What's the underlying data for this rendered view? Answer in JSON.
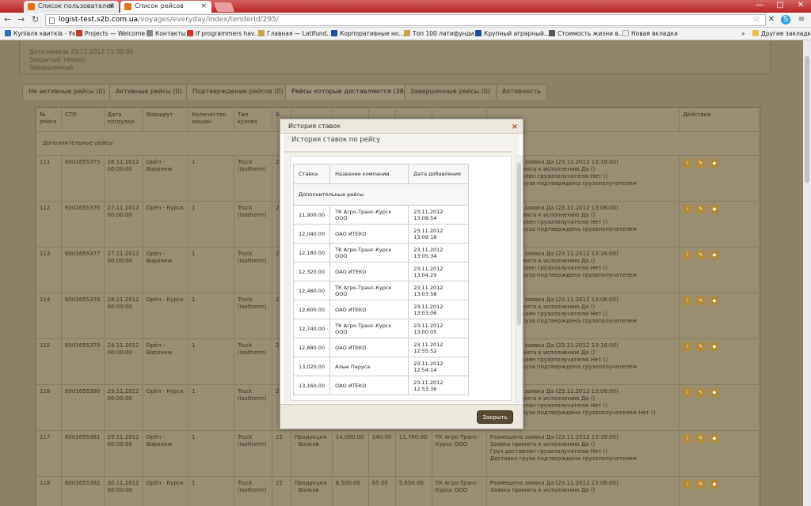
{
  "browser": {
    "tabs": [
      {
        "label": "Список пользователей",
        "close": "×"
      },
      {
        "label": "Список рейсов",
        "close": "×"
      }
    ],
    "window_buttons": {
      "minimize": "—",
      "maximize": "□",
      "close": "✕"
    },
    "nav": {
      "back": "←",
      "forward": "→",
      "reload": "↻"
    },
    "url_host": "logist-test.s2b.com.ua",
    "url_path": "/voyages/everyday/index/tenderId/295/",
    "star": "☆",
    "menu": "≡",
    "bookmarks": [
      {
        "label": "Купівля квитків - Ук...",
        "color": "#2b6fbf"
      },
      {
        "label": "Projects — Welcome",
        "color": "#c0392b"
      },
      {
        "label": "Контакты",
        "color": "#888"
      },
      {
        "label": "If programmers hav...",
        "color": "#d9342b"
      },
      {
        "label": "Главная — Latifund...",
        "color": "#c8a44a"
      },
      {
        "label": "Корпоративные но...",
        "color": "#1f4f9a"
      },
      {
        "label": "Топ 100 латифунди...",
        "color": "#c8a44a"
      },
      {
        "label": "Крупный аграрный...",
        "color": "#1f4f9a"
      },
      {
        "label": "Стоимость жизни в...",
        "color": "#555"
      },
      {
        "label": "Новая вкладка",
        "color": "#ddd"
      }
    ],
    "bookmarks_more": "»",
    "other_bookmarks": "Другие закладки"
  },
  "info": {
    "start": "Дата начала 23.11.2012 11:30:00",
    "type": "Закрытый тендер",
    "status": "Завершенный"
  },
  "page_tabs": [
    "Не активные рейсы (0)",
    "Активные рейсы (0)",
    "Подтверждение рейсов (0)",
    "Рейсы которые доставляются (38)",
    "Завершенные рейсы (0)",
    "Активность"
  ],
  "trips": {
    "caption": "Дополнительные рейсы",
    "headers": [
      "№ рейса",
      "СТО",
      "Дата погрузки",
      "Маршрут",
      "Количество машин",
      "Тип кузова",
      "В",
      "",
      "",
      "",
      "",
      "",
      "",
      "Действия"
    ],
    "rows": [
      {
        "num": "111",
        "sto": "6001655375",
        "date": "26.11.2012 00:00:00",
        "route": "Орёл - Воронеж",
        "qty": "1",
        "body": "Truck (Isotherm)",
        "w": "22",
        "cargo": "",
        "s1": "",
        "s2": "",
        "s3": "",
        "carrier": "",
        "status": [
          "Размещена заявка Да (23.11.2012 13:16:00)",
          "Заявка принята к исполнению Да ()",
          "Груз доставлен грузополучателю Нет ()",
          "Доставка груза подтверждена грузополучателем"
        ]
      },
      {
        "num": "112",
        "sto": "6001655376",
        "date": "27.11.2012 00:00:00",
        "route": "Орёл - Курск",
        "qty": "1",
        "body": "Truck (Isotherm)",
        "w": "22",
        "cargo": "",
        "s1": "",
        "s2": "",
        "s3": "",
        "carrier": "",
        "status": [
          "Размещена заявка Да (23.11.2012 13:06:00)",
          "Заявка принята к исполнению Да ()",
          "Груз доставлен грузополучателю Нет ()",
          "Доставка груза подтверждена грузополучателем"
        ]
      },
      {
        "num": "113",
        "sto": "6001655377",
        "date": "27.11.2012 00:00:00",
        "route": "Орёл - Воронеж",
        "qty": "1",
        "body": "Truck (Isotherm)",
        "w": "22",
        "cargo": "",
        "s1": "",
        "s2": "",
        "s3": "",
        "carrier": "",
        "status": [
          "Размещена заявка Да (23.11.2012 13:16:00)",
          "Заявка принята к исполнению Да ()",
          "Груз доставлен грузополучателю Нет ()",
          "Доставка груза подтверждена грузополучателем"
        ]
      },
      {
        "num": "114",
        "sto": "6001655378",
        "date": "28.11.2012 00:00:00",
        "route": "Орёл - Курск",
        "qty": "1",
        "body": "Truck (Isotherm)",
        "w": "22",
        "cargo": "",
        "s1": "",
        "s2": "",
        "s3": "",
        "carrier": "",
        "status": [
          "Размещена заявка Да (23.11.2012 13:06:00)",
          "Заявка принята к исполнению Да ()",
          "Груз доставлен грузополучателю Нет ()",
          "Доставка груза подтверждена грузополучателем"
        ]
      },
      {
        "num": "115",
        "sto": "6001655379",
        "date": "28.11.2012 00:00:00",
        "route": "Орёл - Воронеж",
        "qty": "1",
        "body": "Truck (Isotherm)",
        "w": "22",
        "cargo": "",
        "s1": "",
        "s2": "",
        "s3": "",
        "carrier": "",
        "status": [
          "Размещена заявка Да (23.11.2012 13:16:00)",
          "Заявка принята к исполнению Да ()",
          "Груз доставлен грузополучателю Нет ()",
          "Доставка груза подтверждена грузополучателем"
        ]
      },
      {
        "num": "116",
        "sto": "6001655380",
        "date": "29.11.2012 00:00:00",
        "route": "Орёл - Курск",
        "qty": "1",
        "body": "Truck (Isotherm)",
        "w": "22",
        "cargo": "",
        "s1": "",
        "s2": "",
        "s3": "",
        "carrier": "",
        "status": [
          "Размещена заявка Да (23.11.2012 13:06:00)",
          "Заявка принята к исполнению Да ()",
          "Груз доставлен грузополучателю Нет ()",
          "Доставка груза подтверждена грузополучателем Нет ()"
        ]
      },
      {
        "num": "117",
        "sto": "6001655381",
        "date": "29.11.2012 00:00:00",
        "route": "Орёл - Воронеж",
        "qty": "1",
        "body": "Truck (Isotherm)",
        "w": "22",
        "cargo": "Продукция - Волков",
        "s1": "14,000.00",
        "s2": "140.00",
        "s3": "11,760.00",
        "carrier": "ТК Агро-Транс-Курск ООО",
        "status": [
          "Размещена заявка Да (23.11.2012 13:16:00)",
          "Заявка принята к исполнению Да ()",
          "Груз доставлен грузополучателю Нет ()",
          "Доставка груза подтверждена грузополучателем"
        ]
      },
      {
        "num": "118",
        "sto": "6001655382",
        "date": "30.11.2012 00:00:00",
        "route": "Орёл - Курск",
        "qty": "1",
        "body": "Truck (Isotherm)",
        "w": "22",
        "cargo": "Продукция - Волков",
        "s1": "6,500.00",
        "s2": "65.00",
        "s3": "5,850.00",
        "carrier": "ТК Агро-Транс-Курск ООО",
        "status": [
          "Размещена заявка Да (23.11.2012 13:06:00)",
          "Заявка принята к исполнению Да ()"
        ]
      }
    ]
  },
  "modal": {
    "title": "История ставок",
    "close": "×",
    "subtitle": "История ставок по рейсу",
    "caption": "Дополнительные рейсы",
    "headers": [
      "Ставка",
      "Название компании",
      "Дата добавления"
    ],
    "rows": [
      [
        "11,900.00",
        "ТК Агро-Транс-Курск ООО",
        "23.11.2012 13:09:54"
      ],
      [
        "12,040.00",
        "ОАО ИТЕКО",
        "23.11.2012 13:09:18"
      ],
      [
        "12,180.00",
        "ТК Агро-Транс-Курск ООО",
        "23.11.2012 13:05:34"
      ],
      [
        "12,320.00",
        "ОАО ИТЕКО",
        "23.11.2012 13:04:29"
      ],
      [
        "12,460.00",
        "ТК Агро-Транс-Курск ООО",
        "23.11.2012 13:03:58"
      ],
      [
        "12,600.00",
        "ОАО ИТЕКО",
        "23.11.2012 13:03:06"
      ],
      [
        "12,740.00",
        "ТК Агро-Транс-Курск ООО",
        "23.11.2012 13:00:05"
      ],
      [
        "12,880.00",
        "ОАО ИТЕКО",
        "23.11.2012 12:55:52"
      ],
      [
        "13,020.00",
        "Алые Паруса",
        "23.11.2012 12:54:14"
      ],
      [
        "13,160.00",
        "ОАО ИТЕКО",
        "23.11.2012 12:53:36"
      ]
    ],
    "close_button": "Закрыть"
  },
  "colors": {
    "accent": "#5a4a30",
    "tabstrip": "#b82525",
    "page_bg": "#8c8066"
  }
}
